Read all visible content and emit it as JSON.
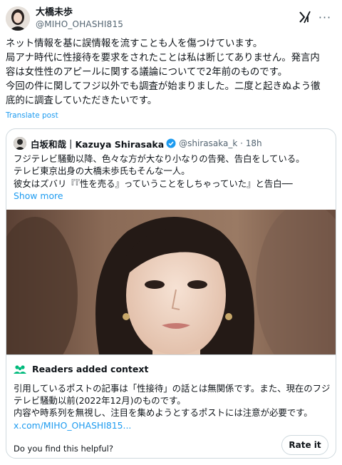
{
  "post": {
    "author_name": "大橋未歩",
    "author_handle": "@MIHO_OHASHI815",
    "body_lines": [
      "ネット情報を基に誤情報を流すことも人を傷つけています。",
      "局アナ時代に性接待を要求をされたことは私は断じてありません。発言内",
      "容は女性性のアピールに関する議論についてで2年前のものです。",
      "今回の件に関してフジ以外でも調査が始まりました。二度と起きぬよう徹",
      "底的に調査していただきたいです。"
    ],
    "translate_label": "Translate post",
    "icons": {
      "grok": "grok-icon",
      "more": "more-icon"
    }
  },
  "quote": {
    "author_name": "白坂和哉｜Kazuya Shirasaka",
    "handle_time": "@shirasaka_k · 18h",
    "body_lines": [
      "フジテレビ騒動以降、色々な方が大なり小なりの告発、告白をしている。",
      "テレビ東京出身の大橋未歩氏もそんな一人。",
      "彼女はズバリ『『性を売る』っていうことをしちゃっていた』と告白──"
    ],
    "show_more": "Show more",
    "verified_color": "#1d9bf0"
  },
  "community_note": {
    "title": "Readers added context",
    "body_lines": [
      "引用しているポストの記事は「性接待」の話とは無関係です。また、現在のフジ",
      "テレビ騒動以前(2022年12月)のものです。",
      "内容や時系列を無視し、注目を集めようとするポストには注意が必要です。"
    ],
    "link": "x.com/MIHO_OHASHI815...",
    "helpful_question": "Do you find this helpful?",
    "rate_label": "Rate it",
    "accent": "#00ba7c"
  },
  "colors": {
    "link": "#1d9bf0",
    "secondary": "#536471",
    "border": "#cfd9de"
  }
}
